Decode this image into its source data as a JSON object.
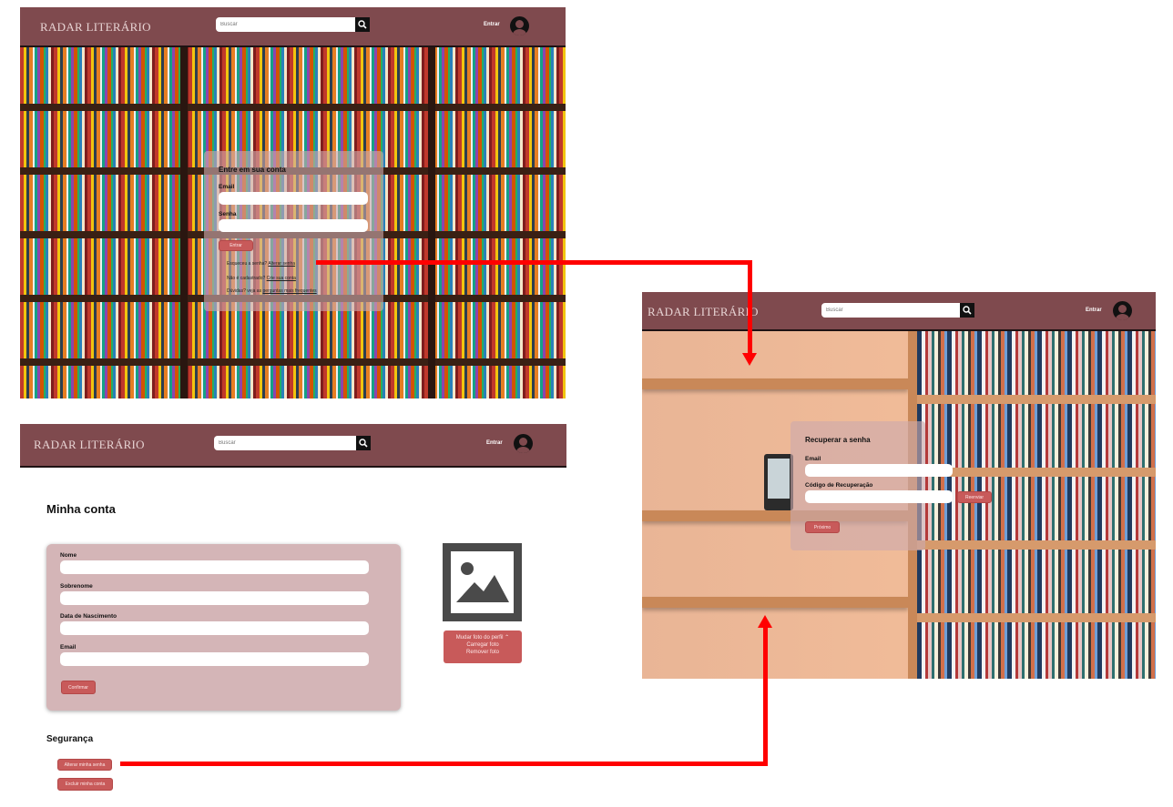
{
  "brand": "RADAR LITERÁRIO",
  "search_placeholder": "Buscar",
  "entrar": "Entrar",
  "login": {
    "title": "Entre em sua conta",
    "email_label": "Email",
    "password_label": "Senha",
    "submit": "Entrar",
    "forgot_prefix": "Esqueceu a senha?",
    "forgot_link": "Alterar senha",
    "register_prefix": "Não é cadastrado?",
    "register_link": "Crie sua conta",
    "faq_prefix": "Dúvidas? veja as",
    "faq_link": "perguntas mais frequentes"
  },
  "recover": {
    "title": "Recuperar a senha",
    "email_label": "Email",
    "code_label": "Código de Recuperação",
    "resend": "Reenviar",
    "next": "Próximo"
  },
  "account": {
    "title": "Minha conta",
    "fields": [
      {
        "label": "Nome"
      },
      {
        "label": "Sobrenome"
      },
      {
        "label": "Data de Nascimento"
      },
      {
        "label": "Email"
      }
    ],
    "confirm": "Confirmar",
    "photo_menu": "Mudar foto do perfil",
    "photo_upload": "Carregar foto",
    "photo_remove": "Remover foto",
    "security_title": "Segurança",
    "change_password": "Alterar minha senha",
    "delete_account": "Excluir minha conta"
  },
  "colors": {
    "header": "#7f4a4e",
    "panel": "#d4b5b7",
    "button": "#c85a5a",
    "arrow": "#ff0000"
  }
}
